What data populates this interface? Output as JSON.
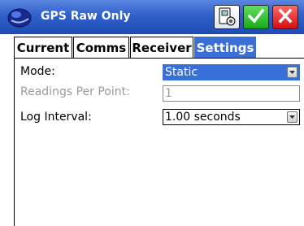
{
  "window": {
    "title": "GPS Raw Only",
    "app_icon": "gps-globe-icon",
    "buttons": {
      "device": "device-settings-icon",
      "ok": "checkmark-icon",
      "cancel": "close-icon"
    }
  },
  "tabs": [
    {
      "label": "Current",
      "active": false
    },
    {
      "label": "Comms",
      "active": false
    },
    {
      "label": "Receiver",
      "active": false
    },
    {
      "label": "Settings",
      "active": true
    }
  ],
  "form": {
    "mode": {
      "label": "Mode:",
      "value": "Static"
    },
    "readings": {
      "label": "Readings Per Point:",
      "value": "1"
    },
    "log_interval": {
      "label": "Log Interval:",
      "value": "1.00 seconds"
    }
  },
  "colors": {
    "titlebar": "#2f5fc9",
    "accent": "#3a6fd8",
    "ok": "#19a81a",
    "cancel": "#d40f0f"
  }
}
